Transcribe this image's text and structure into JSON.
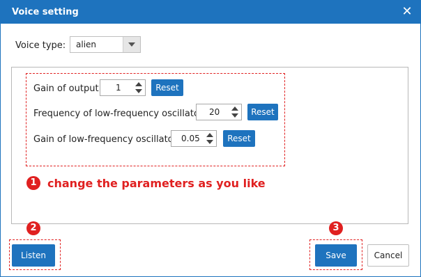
{
  "dialog": {
    "title": "Voice setting",
    "close_label": "✕"
  },
  "voice_type": {
    "label": "Voice type:",
    "selected": "alien"
  },
  "params": [
    {
      "label": "Gain of output:",
      "value": "1",
      "reset_label": "Reset"
    },
    {
      "label": "Frequency of low-frequency oscillator:",
      "value": "20",
      "reset_label": "Reset"
    },
    {
      "label": "Gain of low-frequency oscillator:",
      "value": "0.05",
      "reset_label": "Reset"
    }
  ],
  "annotations": {
    "step1_number": "1",
    "step1_text": "change the parameters as you like",
    "step2_number": "2",
    "step3_number": "3"
  },
  "footer": {
    "listen_label": "Listen",
    "save_label": "Save",
    "cancel_label": "Cancel"
  },
  "colors": {
    "accent": "#1e73be",
    "annotation": "#e02020"
  }
}
